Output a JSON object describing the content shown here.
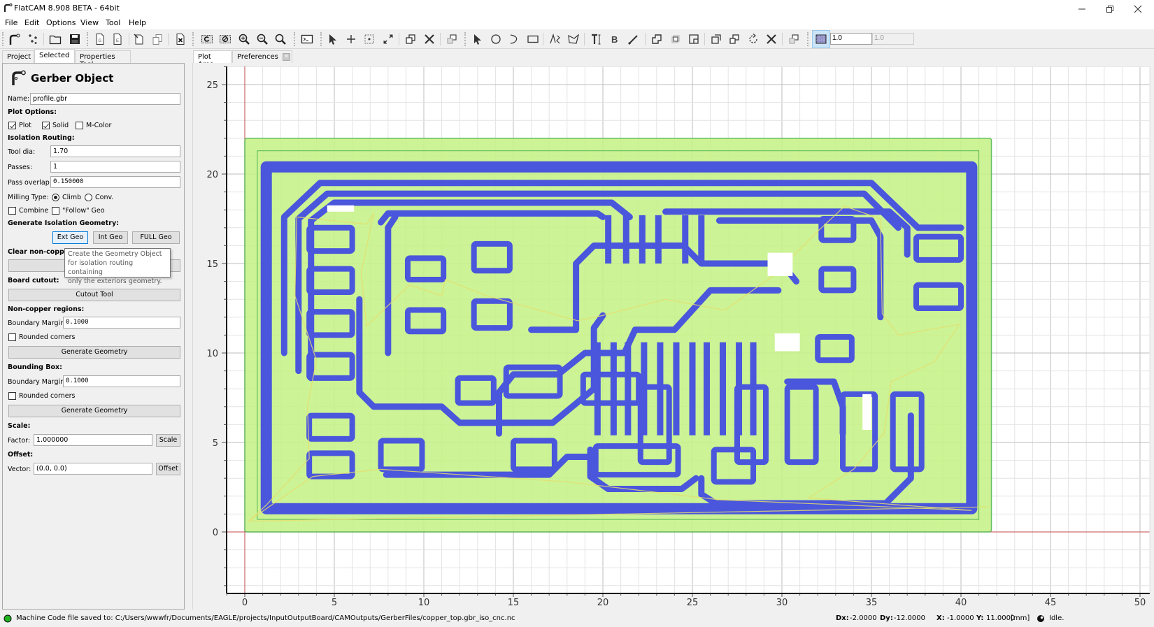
{
  "window": {
    "title": "FlatCAM 8.908 BETA - 64bit",
    "controls": [
      "minimize",
      "restore",
      "close"
    ]
  },
  "menu": [
    "File",
    "Edit",
    "Options",
    "View",
    "Tool",
    "Help"
  ],
  "toolbar": {
    "icons": [
      "flatcam-logo-icon",
      "points-icon",
      "open-folder-icon",
      "save-icon",
      "new-gerber-icon",
      "new-excellon-icon",
      "copy-object-icon",
      "paste-icon",
      "delete-icon",
      "replot-icon",
      "clear-plot-icon",
      "zoom-in-icon",
      "zoom-out-icon",
      "zoom-fit-icon",
      "shell-icon",
      "select-icon",
      "add-point-icon",
      "snap-icon",
      "resize-icon",
      "copy-shape-icon",
      "delete-shape-icon",
      "move-icon",
      "pointer-icon",
      "circle-icon",
      "arc-icon",
      "rectangle-icon",
      "path-icon",
      "polygon-icon",
      "text-icon",
      "buffer-icon",
      "paint-icon",
      "union-icon",
      "intersection-icon",
      "subtraction-icon",
      "cut-icon",
      "copy-icon2",
      "rotate-icon",
      "delete-icon2",
      "move-icon2",
      "grid-snap-icon"
    ],
    "grid_x": "1.0",
    "grid_y": "1.0",
    "grid_lock_checked": true
  },
  "left_tabs": [
    "Project",
    "Selected",
    "Properties Tool"
  ],
  "left_tabs_active": 1,
  "plot_tabs": [
    "Plot Area",
    "Preferences"
  ],
  "panel": {
    "title": "Gerber Object",
    "name_label": "Name:",
    "name_value": "profile.gbr",
    "plot_options_header": "Plot Options:",
    "plot_label": "Plot",
    "plot_checked": true,
    "solid_label": "Solid",
    "solid_checked": true,
    "mcolor_label": "M-Color",
    "mcolor_checked": false,
    "isolation_header": "Isolation Routing:",
    "tool_dia_label": "Tool dia:",
    "tool_dia_value": "1.70",
    "passes_label": "Passes:",
    "passes_value": "1",
    "pass_overlap_label": "Pass overlap:",
    "pass_overlap_value": "0.150000",
    "milling_type_label": "Milling Type:",
    "climb_label": "Climb",
    "conv_label": "Conv.",
    "milling_type_selected": "Climb",
    "combine_label": "Combine",
    "combine_checked": false,
    "follow_label": "\"Follow\" Geo",
    "follow_checked": false,
    "gen_iso_header": "Generate Isolation Geometry:",
    "ext_geo_label": "Ext Geo",
    "int_geo_label": "Int Geo",
    "full_geo_label": "FULL Geo",
    "clear_noncopper_header": "Clear non-coppe",
    "ncc_button_label": "N",
    "tooltip_text": "Create the Geometry Object for isolation routing containing only the exteriors geometry.",
    "tooltip_lines": [
      "Create the Geometry Object",
      "for isolation routing containing",
      "only the exteriors geometry."
    ],
    "board_cutout_header": "Board cutout:",
    "cutout_tool_label": "Cutout Tool",
    "noncopper_header": "Non-copper regions:",
    "noncopper_margin_label": "Boundary Margin:",
    "noncopper_margin_value": "0.1000",
    "noncopper_rounded_label": "Rounded corners",
    "noncopper_rounded_checked": false,
    "noncopper_generate_label": "Generate Geometry",
    "bbox_header": "Bounding Box:",
    "bbox_margin_label": "Boundary Margin:",
    "bbox_margin_value": "0.1000",
    "bbox_rounded_label": "Rounded corners",
    "bbox_rounded_checked": false,
    "bbox_generate_label": "Generate Geometry",
    "scale_header": "Scale:",
    "factor_label": "Factor:",
    "factor_value": "1.000000",
    "scale_button_label": "Scale",
    "offset_header": "Offset:",
    "vector_label": "Vector:",
    "vector_value": "(0.0, 0.0)",
    "offset_button_label": "Offset"
  },
  "plot": {
    "x_ticks": [
      "0",
      "5",
      "10",
      "15",
      "20",
      "25",
      "30",
      "35",
      "40",
      "45",
      "50"
    ],
    "y_ticks": [
      "0",
      "5",
      "10",
      "15",
      "20",
      "25"
    ],
    "x_range": [
      -1,
      50.2
    ],
    "y_range": [
      -3.6,
      26.1
    ],
    "board_outline": [
      0,
      0,
      41.7,
      22
    ],
    "colors": {
      "board_fill": "#c7f28a",
      "board_edge": "#55b755",
      "isolation": "#4a56dc",
      "travel": "#e6de6c",
      "axis_origin": "#c0484b",
      "grid": "#e4e4e4"
    }
  },
  "status": {
    "message": "Machine Code file saved to: C:/Users/wwwfr/Documents/EAGLE/projects/InputOutputBoard/CAMOutputs/GerberFiles/copper_top.gbr_iso_cnc.nc",
    "dx_label": "Dx:",
    "dx_value": "-2.0000",
    "dy_label": "Dy:",
    "dy_value": "-12.0000",
    "x_label": "X:",
    "x_value": "-1.0000",
    "y_label": "Y:",
    "y_value": "11.0000",
    "units": "[mm]",
    "state": "Idle.",
    "status_color": "#21b321"
  }
}
